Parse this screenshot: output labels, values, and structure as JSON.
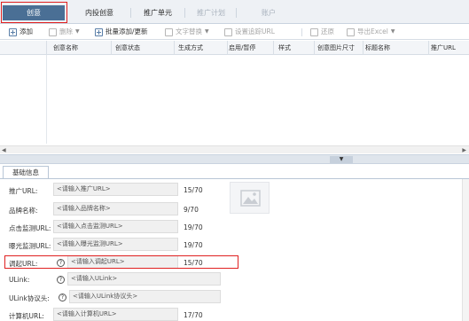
{
  "tabs": [
    {
      "label": "创意",
      "state": "active"
    },
    {
      "label": "内投创意",
      "state": "normal"
    },
    {
      "label": "推广单元",
      "state": "normal"
    },
    {
      "label": "推广计划",
      "state": "disabled"
    },
    {
      "label": "账户",
      "state": "disabled"
    }
  ],
  "toolbar": {
    "add": "添加",
    "delete": "删除",
    "batch_add": "批量添加/更新",
    "text_replace": "文字替换",
    "set_tracking": "设置追踪URL",
    "restore": "还原",
    "export": "导出Excel"
  },
  "grid": {
    "columns": [
      "创意名称",
      "创意状态",
      "生成方式",
      "启用/暂停",
      "样式",
      "创意图片尺寸",
      "标题名称",
      "推广URL"
    ]
  },
  "detail": {
    "tab_label": "基础信息",
    "fields": [
      {
        "label": "推广URL:",
        "placeholder": "<请输入推广URL>",
        "count": "15/70"
      },
      {
        "label": "品牌名称:",
        "placeholder": "<请输入品牌名称>",
        "count": "9/70"
      },
      {
        "label": "点击监测URL:",
        "placeholder": "<请输入点击监测URL>",
        "count": "19/70"
      },
      {
        "label": "曝光监测URL:",
        "placeholder": "<请输入曝光监测URL>",
        "count": "19/70"
      },
      {
        "label": "调起URL:",
        "placeholder": "<请输入调起URL>",
        "count": "15/70"
      },
      {
        "label": "ULink:",
        "placeholder": "<请输入ULink>",
        "count": ""
      },
      {
        "label": "ULink协议头:",
        "placeholder": "<请输入ULink协议头>",
        "count": ""
      },
      {
        "label": "计算机URL:",
        "placeholder": "<请输入计算机URL>",
        "count": "17/70"
      }
    ]
  },
  "colors": {
    "active_tab": "#4a6f95",
    "highlight_border": "#e02020"
  }
}
